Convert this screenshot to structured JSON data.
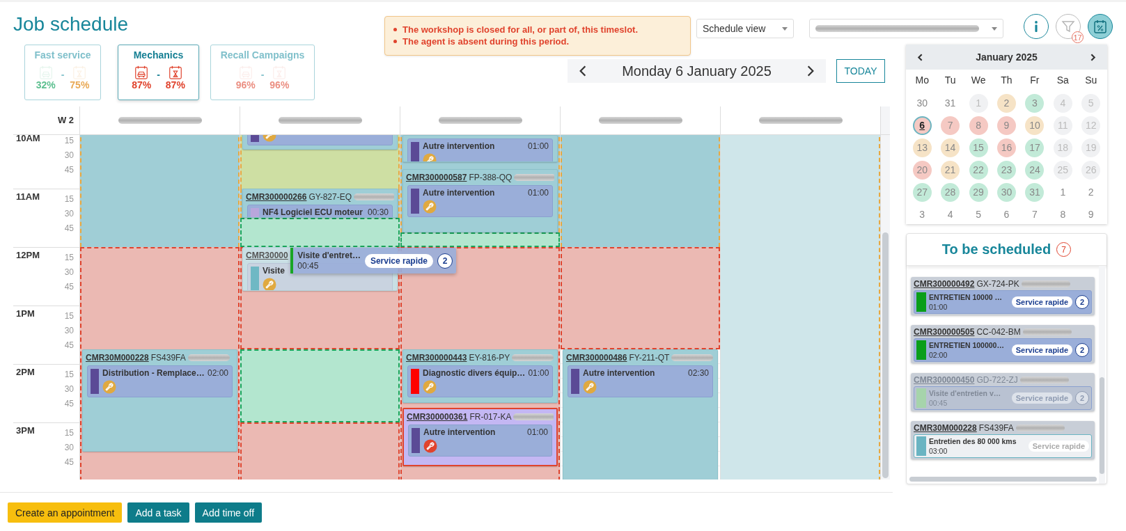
{
  "page": {
    "title": "Job schedule"
  },
  "service_tabs": [
    {
      "label": "Fast service",
      "selected": false,
      "separator": "-",
      "metrics": [
        {
          "kind": "car",
          "value": "32%",
          "color": "#5cbf8f"
        },
        {
          "kind": "hourglass",
          "value": "75%",
          "color": "#e9a955"
        }
      ]
    },
    {
      "label": "Mechanics",
      "selected": true,
      "separator": "-",
      "metrics": [
        {
          "kind": "car",
          "value": "87%",
          "color": "#e0432d"
        },
        {
          "kind": "hourglass",
          "value": "87%",
          "color": "#e0432d"
        }
      ]
    },
    {
      "label": "Recall Campaigns",
      "selected": false,
      "separator": "-",
      "metrics": [
        {
          "kind": "car",
          "value": "96%",
          "color": "#eb8f82"
        },
        {
          "kind": "hourglass",
          "value": "96%",
          "color": "#eb8f82"
        }
      ]
    }
  ],
  "alert": {
    "messages": [
      "The workshop is closed for all, or part of, this timeslot.",
      "The agent is absent during this period."
    ]
  },
  "view_select": {
    "value": "Schedule view"
  },
  "agent_select": {
    "redacted": true
  },
  "toolbar": [
    {
      "kind": "info",
      "disabled": false,
      "selected": false
    },
    {
      "kind": "filter",
      "disabled": true,
      "selected": false,
      "badge": "17"
    },
    {
      "kind": "occupancy",
      "disabled": false,
      "selected": true
    }
  ],
  "date_nav": {
    "label": "Monday 6 January 2025",
    "today": "TODAY"
  },
  "grid": {
    "week": "W 2",
    "time_axis": [
      {
        "label": "10AM",
        "minutes": [
          "15",
          "30",
          "45"
        ]
      },
      {
        "label": "11AM",
        "minutes": [
          "15",
          "30",
          "45"
        ]
      },
      {
        "label": "12PM",
        "minutes": [
          "15",
          "30",
          "45"
        ]
      },
      {
        "label": "1PM",
        "minutes": [
          "15",
          "30",
          "45"
        ]
      },
      {
        "label": "2PM",
        "minutes": [
          "15",
          "30",
          "45"
        ]
      },
      {
        "label": "3PM",
        "minutes": [
          "15",
          "30",
          "45"
        ]
      }
    ],
    "columns": [
      {
        "agent_redacted": true,
        "zones": [
          {
            "kind": "available"
          },
          {
            "kind": "closed"
          }
        ],
        "appointments": [
          {
            "code": "CMR30M000228",
            "plate": "FS439FA",
            "name_redacted": true,
            "selected": false,
            "dragging": false,
            "tasks": [
              {
                "title": "Distribution - Remplace…",
                "duration": "02:00",
                "color": "#5b4a96",
                "alert": false
              }
            ]
          }
        ]
      },
      {
        "agent_redacted": true,
        "zones": [
          {
            "kind": "tentative"
          },
          {
            "kind": "available"
          },
          {
            "kind": "free"
          },
          {
            "kind": "closed"
          },
          {
            "kind": "free"
          },
          {
            "kind": "closed"
          }
        ],
        "appointments": [
          {
            "selected": false,
            "dragging": false,
            "tasks": [
              {
                "color": "#5b4a96",
                "alert": false
              }
            ]
          },
          {
            "code": "CMR300000266",
            "plate": "GY-827-EQ",
            "name_redacted": true,
            "selected": false,
            "dragging": false,
            "tasks": [
              {
                "title": "NF4 Logiciel ECU moteur",
                "duration": "00:30",
                "color": "#b9a6dc"
              }
            ]
          },
          {
            "code": "CMR30000",
            "selected": false,
            "dragging": true,
            "tasks": [
              {
                "title": "Visite",
                "color": "#6fb8c4",
                "alert": false
              }
            ]
          }
        ]
      },
      {
        "agent_redacted": true,
        "zones": [
          {
            "kind": "available"
          },
          {
            "kind": "free"
          },
          {
            "kind": "closed"
          }
        ],
        "appointments": [
          {
            "selected": false,
            "dragging": false,
            "tasks": [
              {
                "title": "Autre intervention",
                "duration": "01:00",
                "color": "#5b4a96",
                "alert": false
              }
            ]
          },
          {
            "code": "CMR300000587",
            "plate": "FP-388-QQ",
            "name_redacted": true,
            "selected": false,
            "dragging": false,
            "tasks": [
              {
                "title": "Autre intervention",
                "duration": "01:00",
                "color": "#5b4a96",
                "alert": false
              }
            ]
          },
          {
            "code": "CMR300000443",
            "plate": "EY-816-PY",
            "name_redacted": true,
            "selected": false,
            "dragging": false,
            "tasks": [
              {
                "title": "Diagnostic divers équip…",
                "duration": "01:00",
                "color": "#ff0000",
                "alert": false
              }
            ]
          },
          {
            "code": "CMR300000361",
            "plate": "FR-017-KA",
            "name_redacted": true,
            "selected": true,
            "dragging": false,
            "tasks": [
              {
                "title": "Autre intervention",
                "duration": "01:00",
                "color": "#5b4a96",
                "alert": true
              }
            ]
          }
        ]
      },
      {
        "agent_redacted": true,
        "zones": [
          {
            "kind": "available"
          },
          {
            "kind": "closed"
          }
        ],
        "appointments": [
          {
            "code": "CMR300000486",
            "plate": "FY-211-QT",
            "name_redacted": true,
            "selected": false,
            "dragging": false,
            "tasks": [
              {
                "title": "Autre intervention",
                "duration": "02:30",
                "color": "#5b4a96",
                "alert": false
              }
            ]
          }
        ]
      },
      {
        "agent_redacted": true,
        "zones": [
          {
            "kind": "off"
          }
        ]
      }
    ],
    "drag_preview": {
      "title": "Visite d'entret…",
      "duration": "00:45",
      "color": "#19a526",
      "tag": "Service rapide",
      "count": "2"
    }
  },
  "calendar": {
    "month": "January 2025",
    "weekdays": [
      "Mo",
      "Tu",
      "We",
      "Th",
      "Fr",
      "Sa",
      "Su"
    ],
    "days": [
      {
        "label": "30",
        "disabled": false,
        "selected": false
      },
      {
        "label": "31",
        "disabled": false,
        "selected": false
      },
      {
        "label": "1",
        "color": "#f0f1f3",
        "disabled": true,
        "selected": false
      },
      {
        "label": "2",
        "color": "#f6e3c6",
        "disabled": false,
        "selected": false
      },
      {
        "label": "3",
        "color": "#c2ead8",
        "disabled": false,
        "selected": false
      },
      {
        "label": "4",
        "color": "#f0f1f3",
        "disabled": true,
        "selected": false
      },
      {
        "label": "5",
        "color": "#f0f1f3",
        "disabled": true,
        "selected": false
      },
      {
        "label": "6",
        "color": "#f5c9c3",
        "disabled": false,
        "selected": true
      },
      {
        "label": "7",
        "color": "#f5c9c3",
        "disabled": false,
        "selected": false
      },
      {
        "label": "8",
        "color": "#f5c9c3",
        "disabled": false,
        "selected": false
      },
      {
        "label": "9",
        "color": "#f5c9c3",
        "disabled": false,
        "selected": false
      },
      {
        "label": "10",
        "color": "#f6e3c6",
        "disabled": false,
        "selected": false
      },
      {
        "label": "11",
        "color": "#f0f1f3",
        "disabled": true,
        "selected": false
      },
      {
        "label": "12",
        "color": "#f0f1f3",
        "disabled": true,
        "selected": false
      },
      {
        "label": "13",
        "color": "#f6e3c6",
        "disabled": false,
        "selected": false
      },
      {
        "label": "14",
        "color": "#f6e3c6",
        "disabled": false,
        "selected": false
      },
      {
        "label": "15",
        "color": "#c2ead8",
        "disabled": false,
        "selected": false
      },
      {
        "label": "16",
        "color": "#f5c9c3",
        "disabled": false,
        "selected": false
      },
      {
        "label": "17",
        "color": "#c2ead8",
        "disabled": false,
        "selected": false
      },
      {
        "label": "18",
        "color": "#f0f1f3",
        "disabled": true,
        "selected": false
      },
      {
        "label": "19",
        "color": "#f0f1f3",
        "disabled": true,
        "selected": false
      },
      {
        "label": "20",
        "color": "#f5c9c3",
        "disabled": false,
        "selected": false
      },
      {
        "label": "21",
        "color": "#f6e3c6",
        "disabled": false,
        "selected": false
      },
      {
        "label": "22",
        "color": "#c2ead8",
        "disabled": false,
        "selected": false
      },
      {
        "label": "23",
        "color": "#c2ead8",
        "disabled": false,
        "selected": false
      },
      {
        "label": "24",
        "color": "#c2ead8",
        "disabled": false,
        "selected": false
      },
      {
        "label": "25",
        "color": "#f0f1f3",
        "disabled": true,
        "selected": false
      },
      {
        "label": "26",
        "color": "#f0f1f3",
        "disabled": true,
        "selected": false
      },
      {
        "label": "27",
        "color": "#c2ead8",
        "disabled": false,
        "selected": false
      },
      {
        "label": "28",
        "color": "#c2ead8",
        "disabled": false,
        "selected": false
      },
      {
        "label": "29",
        "color": "#c2ead8",
        "disabled": false,
        "selected": false
      },
      {
        "label": "30",
        "color": "#c2ead8",
        "disabled": false,
        "selected": false
      },
      {
        "label": "31",
        "color": "#c2ead8",
        "disabled": false,
        "selected": false
      },
      {
        "label": "1",
        "disabled": false,
        "selected": false
      },
      {
        "label": "2",
        "disabled": false,
        "selected": false
      },
      {
        "label": "3",
        "disabled": false,
        "selected": false
      },
      {
        "label": "4",
        "disabled": false,
        "selected": false
      },
      {
        "label": "5",
        "disabled": false,
        "selected": false
      },
      {
        "label": "6",
        "disabled": false,
        "selected": false
      },
      {
        "label": "7",
        "disabled": false,
        "selected": false
      },
      {
        "label": "8",
        "disabled": false,
        "selected": false
      },
      {
        "label": "9",
        "disabled": false,
        "selected": false
      }
    ]
  },
  "to_schedule": {
    "title": "To be scheduled",
    "count": "7",
    "items": [
      {
        "code": "CMR300000492",
        "plate": "GX-724-PK",
        "name_redacted": true,
        "kind": "filled",
        "disabled": false,
        "title": "ENTRETIEN 10000 …",
        "duration": "01:00",
        "color": "#0a9e1a",
        "tag": "Service rapide",
        "count": "2"
      },
      {
        "code": "CMR300000505",
        "plate": "CC-042-BM",
        "name_redacted": true,
        "kind": "filled",
        "disabled": false,
        "title": "ENTRETIEN 100000…",
        "duration": "02:00",
        "color": "#0a9e1a",
        "tag": "Service rapide",
        "count": "2"
      },
      {
        "code": "CMR300000450",
        "plate": "GD-722-ZJ",
        "name_redacted": true,
        "kind": "filled",
        "disabled": true,
        "title": "Visite d'entretien v…",
        "duration": "00:45",
        "color": "#a6d4ab",
        "tag": "Service rapide",
        "count": "2"
      },
      {
        "code": "CMR30M000228",
        "plate": "FS439FA",
        "name_redacted": true,
        "kind": "outlined",
        "disabled": false,
        "title": "Entretien des 80 000 kms",
        "duration": "03:00",
        "color": "#6ab4c2",
        "tag": "Service rapide"
      }
    ]
  },
  "actions": [
    {
      "label": "Create an appointment",
      "kind": "primary"
    },
    {
      "label": "Add a task",
      "kind": "secondary"
    },
    {
      "label": "Add time off",
      "kind": "secondary"
    }
  ]
}
